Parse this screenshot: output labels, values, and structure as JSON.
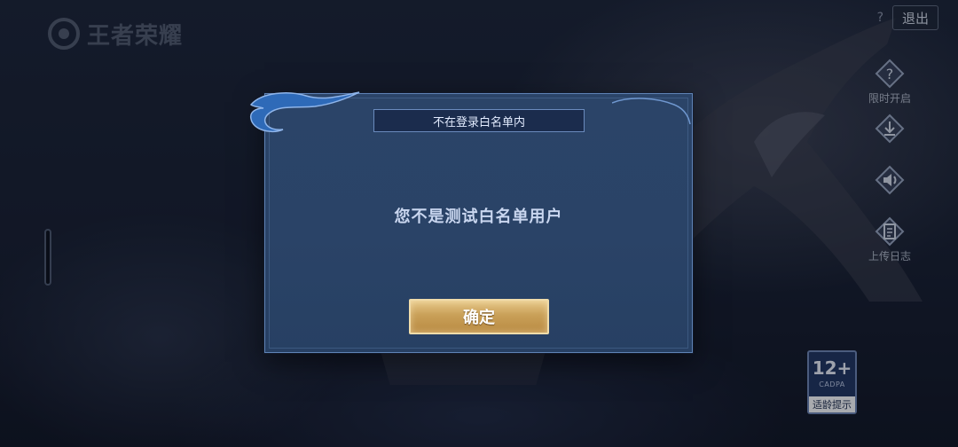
{
  "game": {
    "logo_text": "王者荣耀"
  },
  "top_bar": {
    "help_label": "?",
    "exit_label": "退出"
  },
  "side_menu": {
    "items": [
      {
        "icon": "question-diamond-icon",
        "label": "限时开启"
      },
      {
        "icon": "download-icon",
        "label": ""
      },
      {
        "icon": "speaker-icon",
        "label": ""
      },
      {
        "icon": "document-icon",
        "label": "上传日志"
      }
    ]
  },
  "age_badge": {
    "age": "12+",
    "org": "CADPA",
    "tip": "适龄提示"
  },
  "dialog": {
    "title": "不在登录白名单内",
    "message": "您不是测试白名单用户",
    "confirm_label": "确定"
  },
  "colors": {
    "dialog_bg": "#2a4367",
    "dialog_border": "#5f83b6",
    "button_gold": "#c9a058",
    "message_text": "#c9d6ef"
  }
}
